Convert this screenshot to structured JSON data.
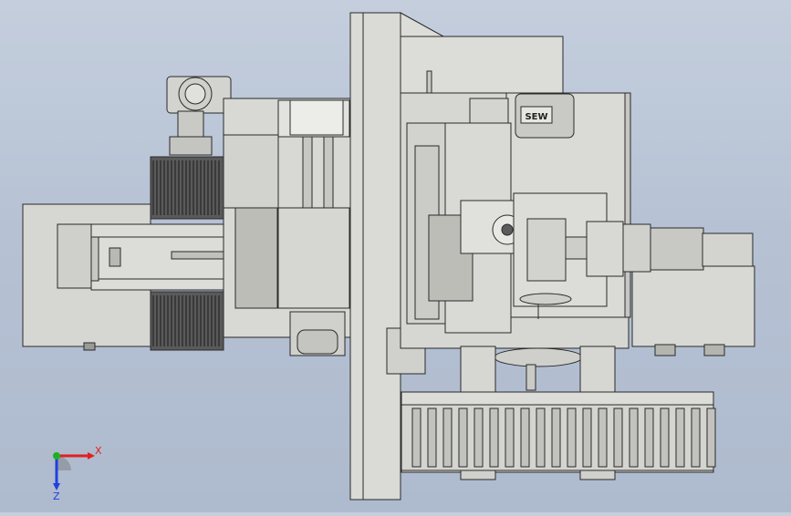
{
  "viewport": {
    "background_top": "#c4cedd",
    "background_bottom": "#aebacd",
    "part_fill": "#d9d9d5",
    "part_fill_dark": "#b9b9b3",
    "edge_color": "#2a2a2a",
    "motor_fill": "#c8c8c4",
    "nameplate_label": "SEW"
  },
  "triad": {
    "x_label": "X",
    "z_label": "Z",
    "x_color": "#e02020",
    "z_color": "#2040e0",
    "y_color": "#20b020"
  }
}
